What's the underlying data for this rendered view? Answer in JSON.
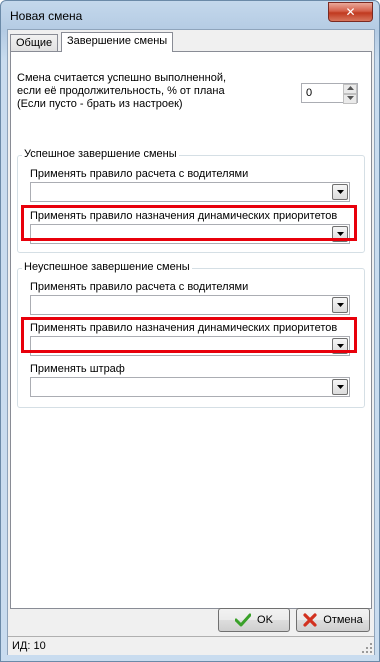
{
  "window": {
    "title": "Новая смена",
    "close_glyph": "✕"
  },
  "tabs": [
    {
      "label": "Общие",
      "active": false
    },
    {
      "label": "Завершение смены",
      "active": true
    }
  ],
  "threshold": {
    "label_lines": [
      "Смена считается успешно выполненной,",
      "если её продолжительность, % от плана",
      "(Если пусто - брать из настроек)"
    ],
    "value": "0"
  },
  "success_group": {
    "title": "Успешное завершение смены",
    "driver_rule_label": "Применять правило расчета с водителями",
    "driver_rule_value": "",
    "priority_rule_label": "Применять правило назначения динамических приоритетов",
    "priority_rule_value": ""
  },
  "failure_group": {
    "title": "Неуспешное завершение смены",
    "driver_rule_label": "Применять правило расчета с водителями",
    "driver_rule_value": "",
    "priority_rule_label": "Применять правило назначения динамических приоритетов",
    "priority_rule_value": "",
    "penalty_label": "Применять штраф",
    "penalty_value": ""
  },
  "buttons": {
    "ok": "OK",
    "cancel": "Отмена"
  },
  "status": {
    "id_text": "ИД: 10"
  },
  "colors": {
    "highlight": "#e8000b",
    "ok_check": "#3aa12a",
    "cancel_x": "#d2311f"
  },
  "icons": {
    "ok": "check-icon",
    "cancel": "cross-icon",
    "dropdown": "chevron-down-icon",
    "resize": "resize-grip-icon"
  }
}
